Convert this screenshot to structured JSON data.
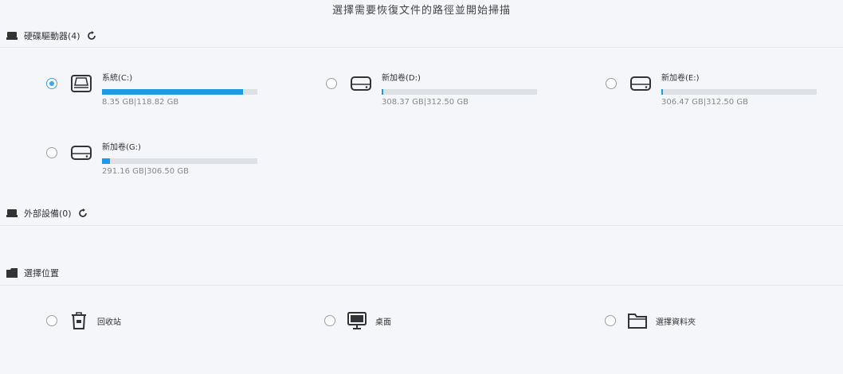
{
  "page_title": "選擇需要恢復文件的路徑並開始掃描",
  "sections": {
    "hard_drives": {
      "label": "硬碟驅動器(4)",
      "icon": "hard-drive-icon"
    },
    "external": {
      "label": "外部設備(0)",
      "icon": "hard-drive-icon"
    },
    "locations": {
      "label": "選擇位置",
      "icon": "folder-icon"
    }
  },
  "drives": [
    {
      "name": "系統(C:)",
      "size": "8.35 GB|118.82 GB",
      "used_fraction": 0.91,
      "selected": true
    },
    {
      "name": "新加卷(D:)",
      "size": "308.37 GB|312.50 GB",
      "used_fraction": 0.01,
      "selected": false
    },
    {
      "name": "新加卷(E:)",
      "size": "306.47 GB|312.50 GB",
      "used_fraction": 0.01,
      "selected": false
    },
    {
      "name": "新加卷(G:)",
      "size": "291.16 GB|306.50 GB",
      "used_fraction": 0.05,
      "selected": false
    }
  ],
  "locations": [
    {
      "label": "回收站",
      "icon": "recycle-bin-icon"
    },
    {
      "label": "桌面",
      "icon": "desktop-icon"
    },
    {
      "label": "選擇資料夾",
      "icon": "folder-icon"
    }
  ],
  "colors": {
    "accent": "#1a9be8",
    "background": "#f4f6f9",
    "bar_track": "#dde1e6"
  }
}
